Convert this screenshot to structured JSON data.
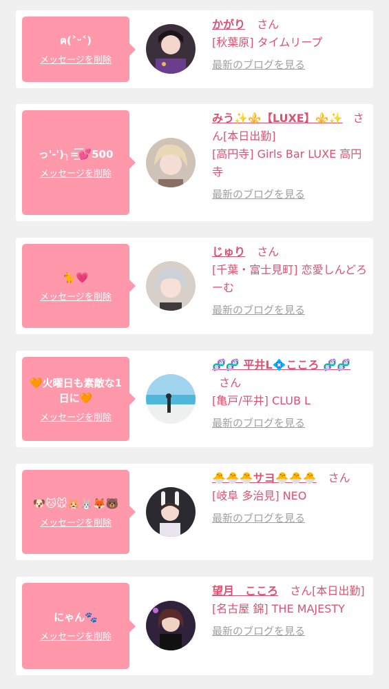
{
  "delete_label": "メッセージを削除",
  "blog_label": "最新のブログを見る",
  "san": "さん",
  "cards": [
    {
      "message": "ฅ(˃ᵕ˂)",
      "name": "かがり",
      "suffix": "",
      "shop": "[秋葉原] タイムリープ"
    },
    {
      "message": "っ'-')╮=͟͟͞͞💕500",
      "name": "みう✨⚜️【LUXE】⚜️✨",
      "suffix": "[本日出勤]",
      "shop": "[高円寺] Girls Bar LUXE 高円寺"
    },
    {
      "message": "🐈💗",
      "name": "じゅり",
      "suffix": "",
      "shop": "[千葉・富士見町] 恋愛しんどろーむ"
    },
    {
      "message": "🧡火曜日も素敵な1日に🧡",
      "name": "🧬🧬 平井L💠こころ 🧬🧬",
      "suffix": "",
      "shop": "[亀戸/平井] CLUB L"
    },
    {
      "message": "🐶🐱🐭🐹🐰🦊🐻",
      "name": "🐣🐣🐣サヨ🐣🐣🐣",
      "suffix": "",
      "shop": "[岐阜 多治見] NEO"
    },
    {
      "message": "にゃん🐾",
      "name": "望月　こころ",
      "suffix": "[本日出勤]",
      "shop": "[名古屋 錦] THE MAJESTY"
    }
  ]
}
